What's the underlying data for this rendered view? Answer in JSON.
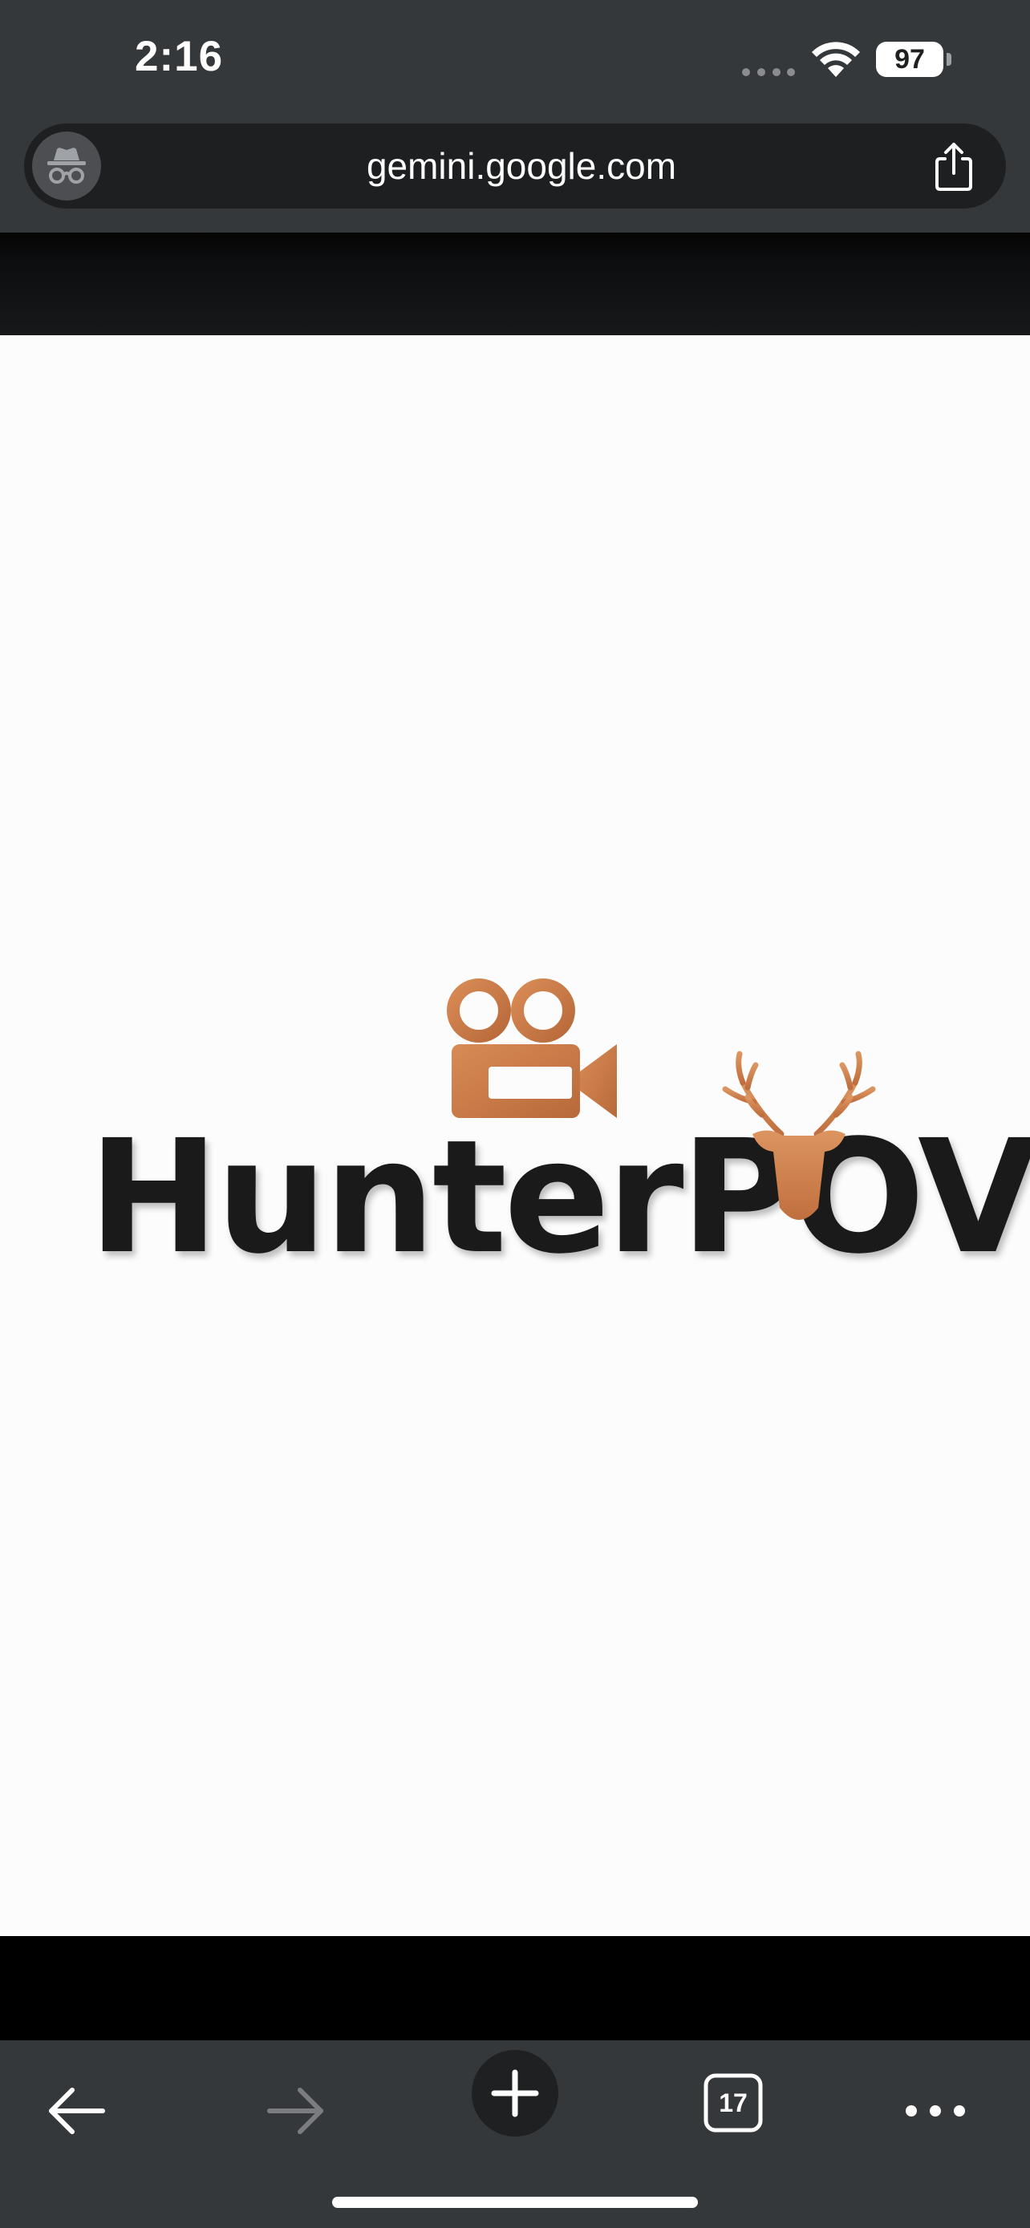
{
  "status_bar": {
    "time": "2:16",
    "battery_level": "97",
    "cell_icon": "cellular-signal-icon",
    "wifi_icon": "wifi-icon"
  },
  "address_bar": {
    "url": "gemini.google.com",
    "incognito_icon": "incognito-icon",
    "share_icon": "share-icon"
  },
  "page": {
    "logo_text": "HunterPOV",
    "camera_icon": "video-camera-icon",
    "deer_icon": "deer-head-icon",
    "accent_color": "#c97a45",
    "wordmark_color": "#1a1a1a"
  },
  "toolbar": {
    "back_icon": "back-arrow-icon",
    "forward_icon": "forward-arrow-icon",
    "new_tab_icon": "plus-icon",
    "tab_count": "17",
    "menu_icon": "more-dots-icon"
  }
}
